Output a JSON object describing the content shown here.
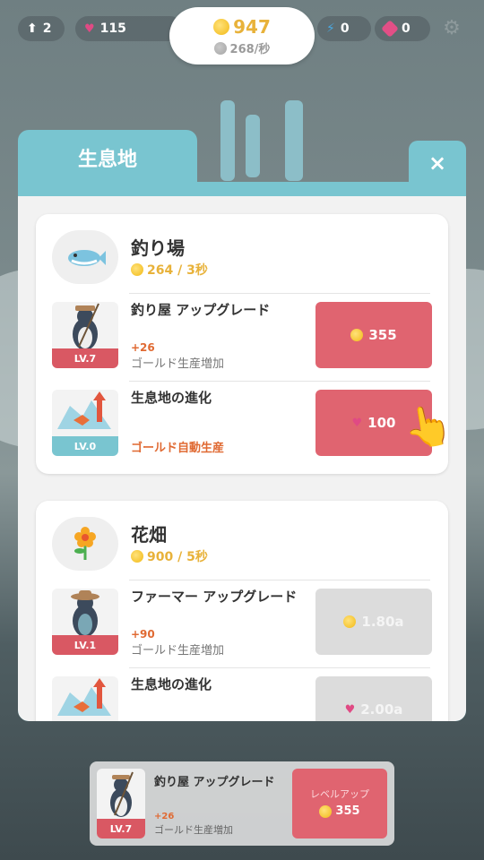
{
  "top": {
    "level": "2",
    "hearts": "115",
    "gold": "947",
    "gold_rate": "268/秒",
    "energy": "0",
    "gems": "0"
  },
  "modal": {
    "tab_label": "生息地",
    "close_label": "×"
  },
  "habitats": [
    {
      "title": "釣り場",
      "rate": "264 / 3秒",
      "upgrade": {
        "title": "釣り屋 アップグレード",
        "level": "LV.7",
        "bonus": "+26",
        "desc": "ゴールド生産増加",
        "cost": "355"
      },
      "evolve": {
        "title": "生息地の進化",
        "level": "LV.0",
        "desc": "ゴールド自動生産",
        "cost": "100"
      }
    },
    {
      "title": "花畑",
      "rate": "900 / 5秒",
      "upgrade": {
        "title": "ファーマー アップグレード",
        "level": "LV.1",
        "bonus": "+90",
        "desc": "ゴールド生産増加",
        "cost": "1.80a"
      },
      "evolve": {
        "title": "生息地の進化",
        "cost": "2.00a"
      }
    }
  ],
  "bottom_bar": {
    "title": "釣り屋 アップグレード",
    "level": "LV.7",
    "bonus": "+26",
    "desc": "ゴールド生産増加",
    "button_label": "レベルアップ",
    "cost": "355"
  },
  "colors": {
    "accent_teal": "#79c5d0",
    "buy_red": "#e06470",
    "gold": "#e8b23a",
    "bonus_orange": "#e06a33"
  }
}
